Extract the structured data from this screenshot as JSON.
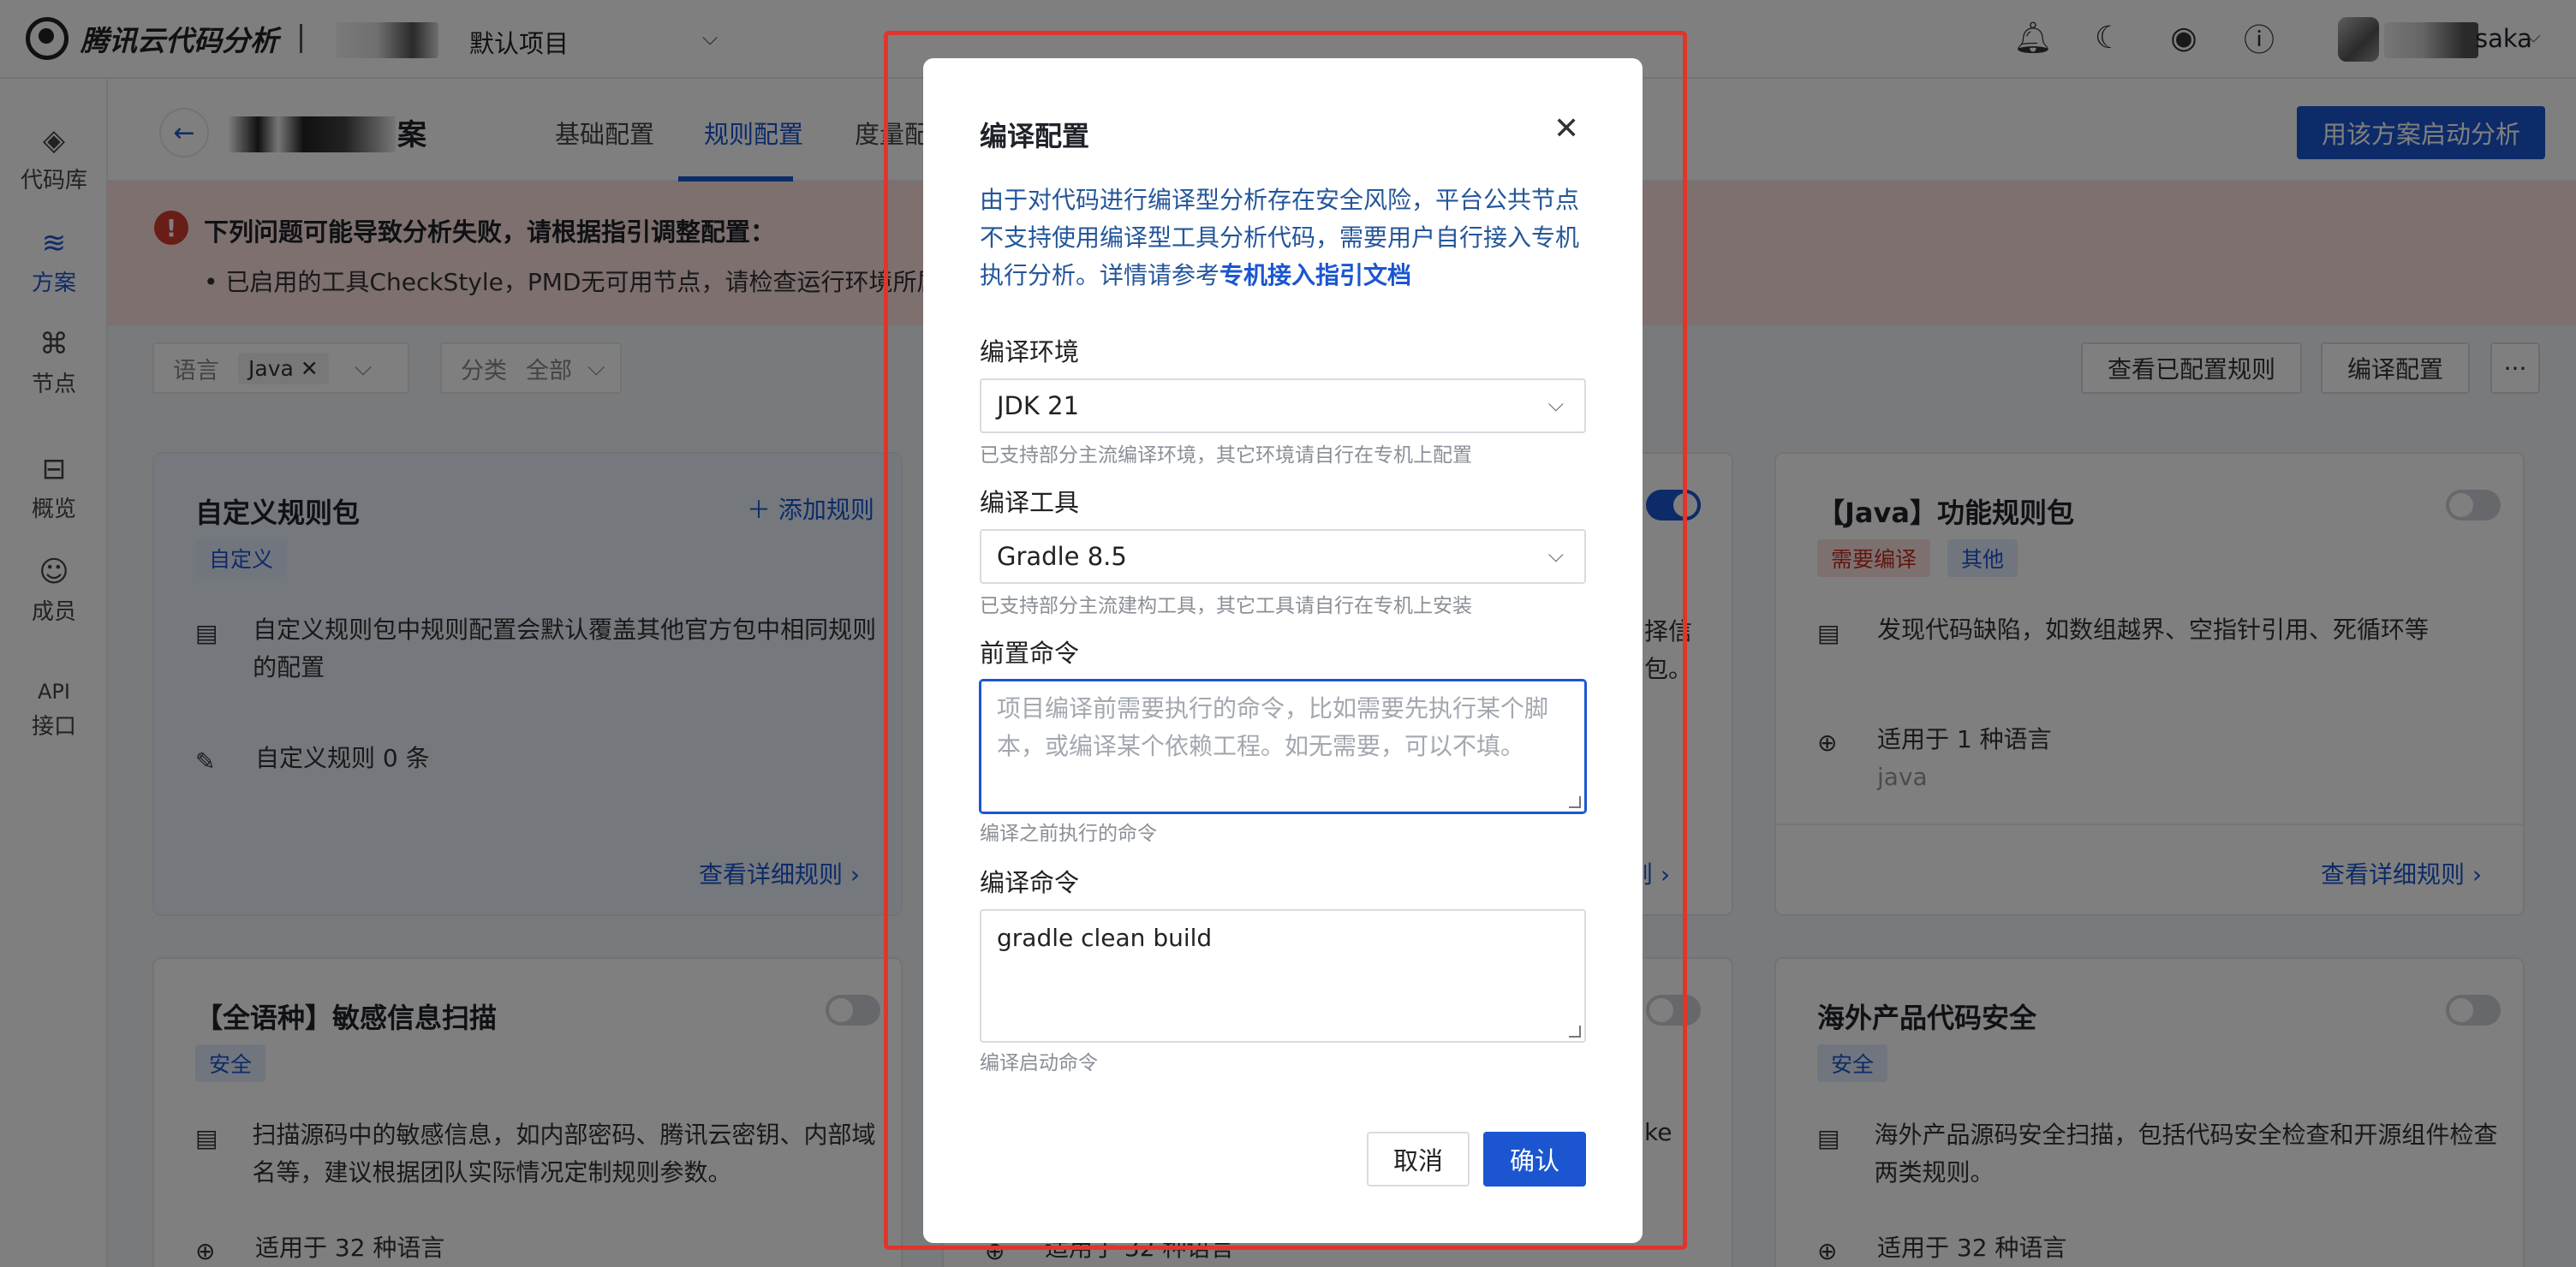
{
  "app": {
    "logo_text": "腾讯云代码分析",
    "project": "默认项目",
    "username": "saka"
  },
  "nav": [
    {
      "label": "代码库",
      "icon": "◈"
    },
    {
      "label": "方案",
      "icon": "≋"
    },
    {
      "label": "节点",
      "icon": "⌘"
    },
    {
      "label": "概览",
      "icon": "⊟"
    },
    {
      "label": "成员",
      "icon": "☺"
    },
    {
      "label": "接口",
      "icon": "API"
    }
  ],
  "header": {
    "plan_name_suffix": "案",
    "tabs": [
      "基础配置",
      "规则配置",
      "度量配"
    ],
    "start_button": "用该方案启动分析"
  },
  "banner": {
    "title": "下列问题可能导致分析失败，请根据指引调整配置：",
    "item": "已启用的工具CheckStyle，PMD无可用节点，请检查运行环境所属"
  },
  "filters": {
    "lang_label": "语言",
    "lang_value": "Java",
    "cat_label": "分类",
    "cat_value": "全部",
    "view_rules": "查看已配置规则",
    "compile_config": "编译配置",
    "more": "···"
  },
  "cards": {
    "custom": {
      "title": "自定义规则包",
      "add": "添加规则",
      "tag": "自定义",
      "desc": "自定义规则包中规则配置会默认覆盖其他官方包中相同规则的配置",
      "count": "自定义规则 0 条",
      "link": "查看详细规则"
    },
    "middle_top": {
      "frag1": "择信",
      "frag2": "包。",
      "link": "则"
    },
    "java": {
      "title": "【Java】功能规则包",
      "tags": [
        "需要编译",
        "其他"
      ],
      "desc": "发现代码缺陷，如数组越界、空指针引用、死循环等",
      "lang_count": "适用于 1 种语言",
      "lang_sub": "java",
      "link": "查看详细规则"
    },
    "sensitive": {
      "title": "【全语种】敏感信息扫描",
      "tag": "安全",
      "desc": "扫描源码中的敏感信息，如内部密码、腾讯云密钥、内部域名等，建议根据团队实际情况定制规则参数。",
      "lang_count": "适用于 32 种语言"
    },
    "middle_bottom": {
      "frag": "ke",
      "lang_count": "适用于 32 种语言"
    },
    "overseas": {
      "title": "海外产品代码安全",
      "tag": "安全",
      "desc": "海外产品源码安全扫描，包括代码安全检查和开源组件检查两类规则。",
      "lang_count": "适用于 32 种语言"
    }
  },
  "modal": {
    "title": "编译配置",
    "desc": "由于对代码进行编译型分析存在安全风险，平台公共节点不支持使用编译型工具分析代码，需要用户自行接入专机执行分析。详情请参考",
    "desc_link": "专机接入指引文档",
    "env_label": "编译环境",
    "env_value": "JDK 21",
    "env_hint": "已支持部分主流编译环境，其它环境请自行在专机上配置",
    "tool_label": "编译工具",
    "tool_value": "Gradle 8.5",
    "tool_hint": "已支持部分主流建构工具，其它工具请自行在专机上安装",
    "pre_label": "前置命令",
    "pre_placeholder": "项目编译前需要执行的命令，比如需要先执行某个脚本，或编译某个依赖工程。如无需要，可以不填。",
    "pre_hint": "编译之前执行的命令",
    "cmd_label": "编译命令",
    "cmd_value": "gradle clean build",
    "cmd_hint": "编译启动命令",
    "cancel": "取消",
    "confirm": "确认"
  }
}
